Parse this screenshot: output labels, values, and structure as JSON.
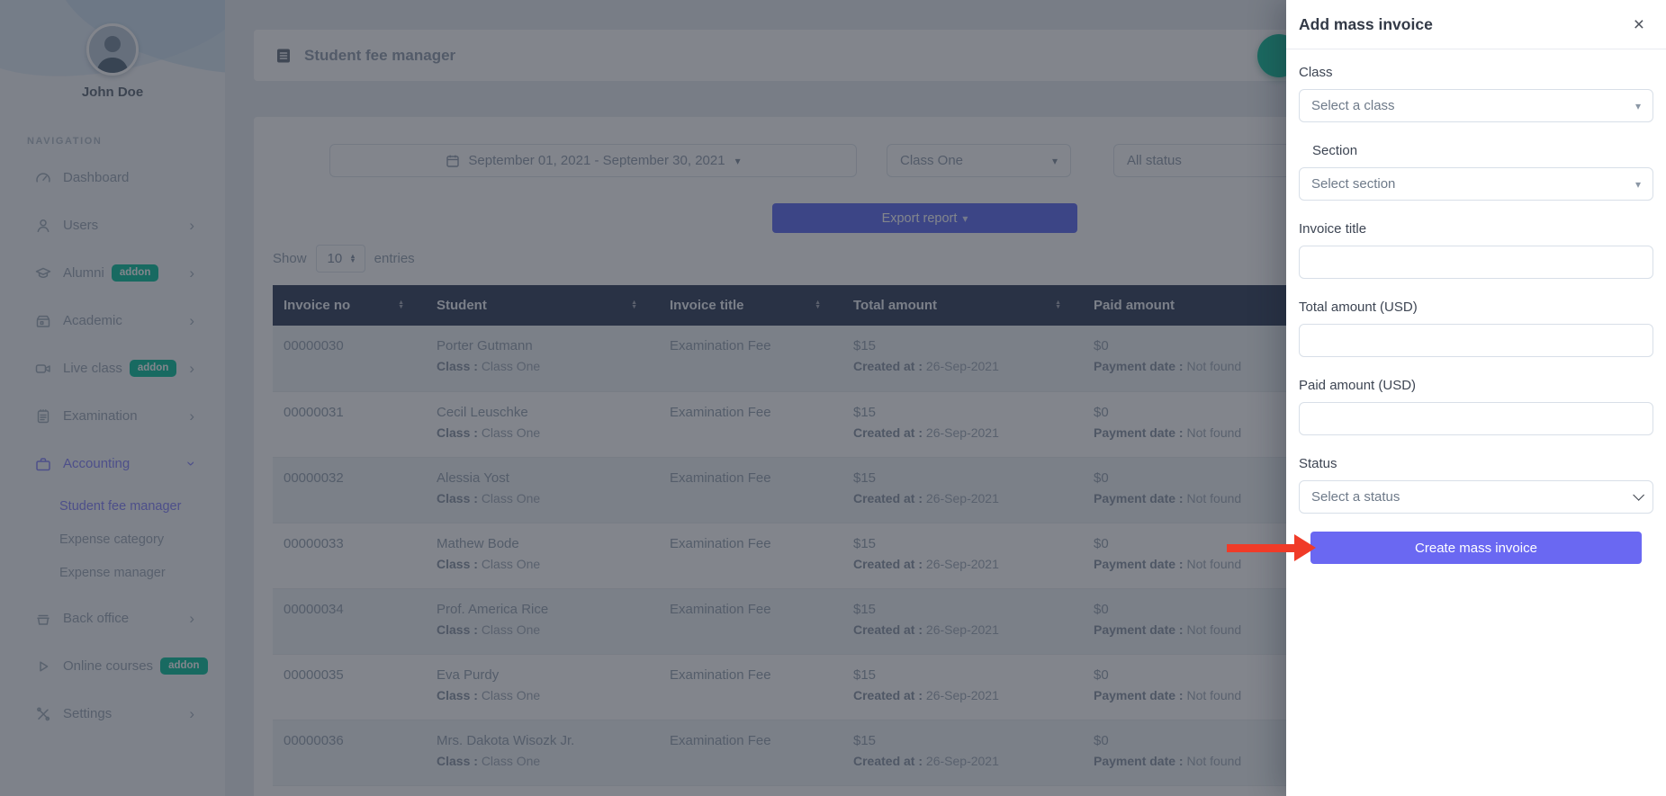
{
  "colors": {
    "accent_indigo": "#6571f2",
    "modal_button": "#6a68f2",
    "badge_green": "#15c4a0",
    "table_header_bg": "#3b4863",
    "active_purple": "#8a88fb",
    "arrow_red": "#f03b28"
  },
  "sidebar": {
    "user_name": "John Doe",
    "nav_heading": "NAVIGATION",
    "items": [
      {
        "label": "Dashboard"
      },
      {
        "label": "Users"
      },
      {
        "label": "Alumni",
        "badge": "addon"
      },
      {
        "label": "Academic"
      },
      {
        "label": "Live class",
        "badge": "addon"
      },
      {
        "label": "Examination"
      },
      {
        "label": "Accounting"
      },
      {
        "label": "Back office"
      },
      {
        "label": "Online courses",
        "badge": "addon"
      },
      {
        "label": "Settings"
      }
    ],
    "accounting_submenu": [
      {
        "label": "Student fee manager"
      },
      {
        "label": "Expense category"
      },
      {
        "label": "Expense manager"
      }
    ]
  },
  "header": {
    "title": "Student fee manager"
  },
  "filters": {
    "date_range": "September 01, 2021 - September 30, 2021",
    "class_selected": "Class One",
    "status_selected": "All status",
    "export_label": "Export report"
  },
  "table": {
    "show_label": "Show",
    "per_page": "10",
    "entries_label": "entries",
    "columns": [
      "Invoice no",
      "Student",
      "Invoice title",
      "Total amount",
      "Paid amount"
    ],
    "meta": {
      "class_label": "Class :",
      "created_label": "Created at :",
      "payment_label": "Payment date :"
    },
    "rows": [
      {
        "invoice_no": "00000030",
        "student": "Porter Gutmann",
        "class_value": "Class One",
        "invoice_title": "Examination Fee",
        "total": "$15",
        "created": "26-Sep-2021",
        "paid": "$0",
        "payment": "Not found"
      },
      {
        "invoice_no": "00000031",
        "student": "Cecil Leuschke",
        "class_value": "Class One",
        "invoice_title": "Examination Fee",
        "total": "$15",
        "created": "26-Sep-2021",
        "paid": "$0",
        "payment": "Not found"
      },
      {
        "invoice_no": "00000032",
        "student": "Alessia Yost",
        "class_value": "Class One",
        "invoice_title": "Examination Fee",
        "total": "$15",
        "created": "26-Sep-2021",
        "paid": "$0",
        "payment": "Not found"
      },
      {
        "invoice_no": "00000033",
        "student": "Mathew Bode",
        "class_value": "Class One",
        "invoice_title": "Examination Fee",
        "total": "$15",
        "created": "26-Sep-2021",
        "paid": "$0",
        "payment": "Not found"
      },
      {
        "invoice_no": "00000034",
        "student": "Prof. America Rice",
        "class_value": "Class One",
        "invoice_title": "Examination Fee",
        "total": "$15",
        "created": "26-Sep-2021",
        "paid": "$0",
        "payment": "Not found"
      },
      {
        "invoice_no": "00000035",
        "student": "Eva Purdy",
        "class_value": "Class One",
        "invoice_title": "Examination Fee",
        "total": "$15",
        "created": "26-Sep-2021",
        "paid": "$0",
        "payment": "Not found"
      },
      {
        "invoice_no": "00000036",
        "student": "Mrs. Dakota Wisozk Jr.",
        "class_value": "Class One",
        "invoice_title": "Examination Fee",
        "total": "$15",
        "created": "26-Sep-2021",
        "paid": "$0",
        "payment": "Not found"
      }
    ]
  },
  "modal": {
    "title": "Add mass invoice",
    "close": "×",
    "fields": {
      "class_label": "Class",
      "class_value": "Select a class",
      "section_label": "Section",
      "section_value": "Select section",
      "invoice_title_label": "Invoice title",
      "invoice_title_value": "",
      "total_label": "Total amount (USD)",
      "total_value": "",
      "paid_label": "Paid amount (USD)",
      "paid_value": "",
      "status_label": "Status",
      "status_value": "Select a status"
    },
    "submit_label": "Create mass invoice"
  }
}
